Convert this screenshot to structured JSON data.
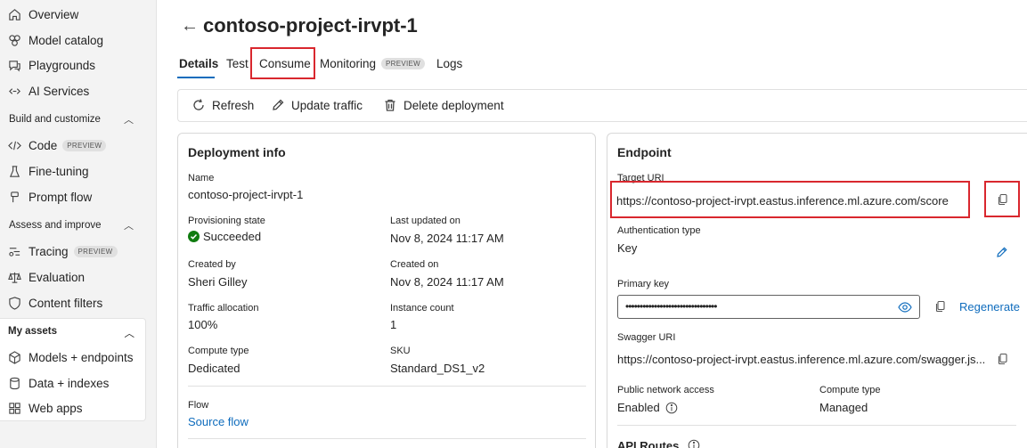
{
  "sidebar": {
    "items_top": [
      {
        "label": "Overview",
        "icon": "home-icon"
      },
      {
        "label": "Model catalog",
        "icon": "cube-icon"
      },
      {
        "label": "Playgrounds",
        "icon": "chat-icon"
      },
      {
        "label": "AI Services",
        "icon": "link-icon"
      }
    ],
    "build": {
      "header": "Build and customize",
      "items": [
        {
          "label": "Code",
          "badge": "PREVIEW",
          "icon": "code-icon"
        },
        {
          "label": "Fine-tuning",
          "icon": "flask-icon"
        },
        {
          "label": "Prompt flow",
          "icon": "flow-icon"
        }
      ]
    },
    "assess": {
      "header": "Assess and improve",
      "items": [
        {
          "label": "Tracing",
          "badge": "PREVIEW",
          "icon": "tracing-icon"
        },
        {
          "label": "Evaluation",
          "icon": "scale-icon"
        },
        {
          "label": "Content filters",
          "icon": "shield-icon"
        }
      ]
    },
    "assets": {
      "header": "My assets",
      "items": [
        {
          "label": "Models + endpoints",
          "icon": "cube-icon"
        },
        {
          "label": "Data + indexes",
          "icon": "database-icon"
        },
        {
          "label": "Web apps",
          "icon": "grid-icon"
        }
      ]
    }
  },
  "header": {
    "title": "contoso-project-irvpt-1",
    "tabs": [
      {
        "label": "Details"
      },
      {
        "label": "Test"
      },
      {
        "label": "Consume"
      },
      {
        "label": "Monitoring",
        "badge": "PREVIEW"
      },
      {
        "label": "Logs"
      }
    ]
  },
  "toolbar": {
    "refresh": "Refresh",
    "update_traffic": "Update traffic",
    "delete_deployment": "Delete deployment"
  },
  "deployment_info": {
    "title": "Deployment info",
    "name_label": "Name",
    "name_value": "contoso-project-irvpt-1",
    "prov_label": "Provisioning state",
    "prov_value": "Succeeded",
    "updated_label": "Last updated on",
    "updated_value": "Nov 8, 2024 11:17 AM",
    "created_by_label": "Created by",
    "created_by_value": "Sheri Gilley",
    "created_on_label": "Created on",
    "created_on_value": "Nov 8, 2024 11:17 AM",
    "traffic_label": "Traffic allocation",
    "traffic_value": "100%",
    "instance_label": "Instance count",
    "instance_value": "1",
    "compute_label": "Compute type",
    "compute_value": "Dedicated",
    "sku_label": "SKU",
    "sku_value": "Standard_DS1_v2",
    "flow_label": "Flow",
    "flow_link": "Source flow"
  },
  "endpoint": {
    "title": "Endpoint",
    "target_label": "Target URI",
    "target_value": "https://contoso-project-irvpt.eastus.inference.ml.azure.com/score",
    "auth_label": "Authentication type",
    "auth_value": "Key",
    "key_label": "Primary key",
    "key_value": "••••••••••••••••••••••••••••••••",
    "regenerate": "Regenerate",
    "swagger_label": "Swagger URI",
    "swagger_value": "https://contoso-project-irvpt.eastus.inference.ml.azure.com/swagger.js...",
    "public_label": "Public network access",
    "public_value": "Enabled",
    "compute_label": "Compute type",
    "compute_value": "Managed",
    "api_routes_label": "API Routes"
  },
  "colors": {
    "accent": "#0f6cbd",
    "highlight": "#d9272e",
    "success": "#107c10"
  }
}
